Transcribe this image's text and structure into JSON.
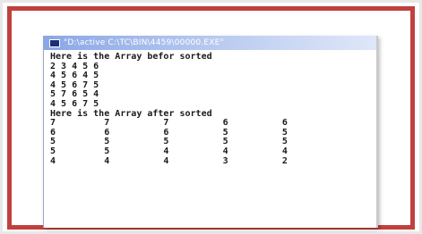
{
  "window": {
    "title": "\"D:\\active C:\\TC\\BIN\\4459\\00000.EXE\""
  },
  "console": {
    "lines": [
      "Here is the Array befor sorted",
      "2 3 4 5 6",
      "4 5 6 4 5",
      "4 5 6 7 5",
      "5 7 6 5 4",
      "4 5 6 7 5",
      "Here is the Array after sorted",
      "7         7          7          6          6",
      "6         6          6          5          5",
      "5         5          5          5          5",
      "5         5          4          4          4",
      "4         4          4          3          2"
    ]
  }
}
